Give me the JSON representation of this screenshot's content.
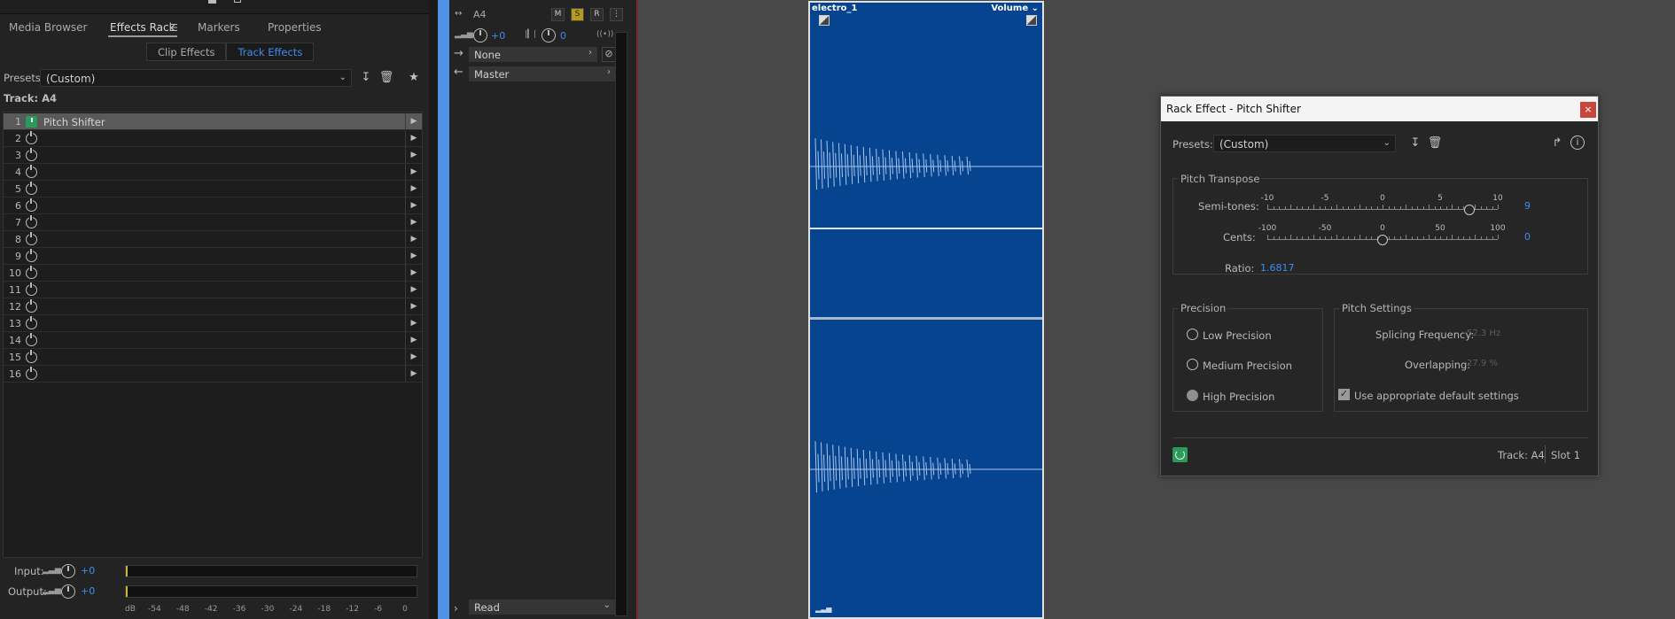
{
  "tabs": {
    "media_browser": "Media Browser",
    "effects_rack": "Effects Rack",
    "markers": "Markers",
    "properties": "Properties"
  },
  "subtabs": {
    "clip_effects": "Clip Effects",
    "track_effects": "Track Effects"
  },
  "presets": {
    "label": "Presets:",
    "value": "(Custom)"
  },
  "track_label": "Track: A4",
  "slots": [
    {
      "num": "1",
      "name": "Pitch Shifter"
    },
    {
      "num": "2",
      "name": ""
    },
    {
      "num": "3",
      "name": ""
    },
    {
      "num": "4",
      "name": ""
    },
    {
      "num": "5",
      "name": ""
    },
    {
      "num": "6",
      "name": ""
    },
    {
      "num": "7",
      "name": ""
    },
    {
      "num": "8",
      "name": ""
    },
    {
      "num": "9",
      "name": ""
    },
    {
      "num": "10",
      "name": ""
    },
    {
      "num": "11",
      "name": ""
    },
    {
      "num": "12",
      "name": ""
    },
    {
      "num": "13",
      "name": ""
    },
    {
      "num": "14",
      "name": ""
    },
    {
      "num": "15",
      "name": ""
    },
    {
      "num": "16",
      "name": ""
    }
  ],
  "io": {
    "input_label": "Input:",
    "input_value": "+0",
    "output_label": "Output:",
    "output_value": "+0",
    "db_scale": [
      "dB",
      "-54",
      "-48",
      "-42",
      "-36",
      "-30",
      "-24",
      "-18",
      "-12",
      "-6",
      "0"
    ]
  },
  "mixer": {
    "track_name": "A4",
    "m": "M",
    "s": "S",
    "r": "R",
    "volume": "+0",
    "pan": "0",
    "input_route": "None",
    "output_route": "Master",
    "automation": "Read"
  },
  "clip": {
    "name": "electro_1",
    "volume_label": "Volume"
  },
  "dialog": {
    "title": "Rack Effect - Pitch Shifter",
    "close": "×",
    "presets_label": "Presets:",
    "presets_value": "(Custom)",
    "pitch_transpose": {
      "title": "Pitch Transpose",
      "semitones_label": "Semi-tones:",
      "semitones_value": "9",
      "semitones_ticks": [
        "-10",
        "-5",
        "0",
        "5",
        "10"
      ],
      "cents_label": "Cents:",
      "cents_value": "0",
      "cents_ticks": [
        "-100",
        "-50",
        "0",
        "50",
        "100"
      ],
      "ratio_label": "Ratio:",
      "ratio_value": "1.6817"
    },
    "precision": {
      "title": "Precision",
      "options": [
        "Low Precision",
        "Medium Precision",
        "High Precision"
      ],
      "selected": "High Precision"
    },
    "pitch_settings": {
      "title": "Pitch Settings",
      "splicing_label": "Splicing Frequency:",
      "splicing_value": "52.3 Hz",
      "overlapping_label": "Overlapping:",
      "overlapping_value": "27.9 %",
      "default_label": "Use appropriate default settings",
      "default_checked": true
    },
    "footer": {
      "track": "Track: A4",
      "slot": "Slot 1"
    }
  }
}
